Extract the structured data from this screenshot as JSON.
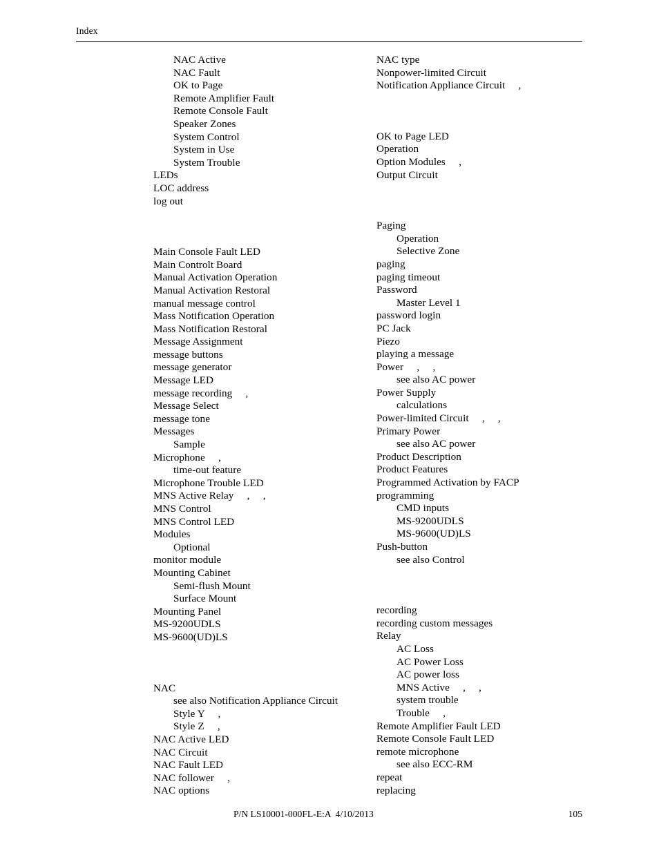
{
  "header": {
    "running_head": "Index"
  },
  "footer": {
    "part_number_line": "P/N LS10001-000FL-E:A  4/10/2013",
    "page_number": "105"
  },
  "index": {
    "left_column": [
      {
        "level": 2,
        "text": "NAC Active"
      },
      {
        "level": 2,
        "text": "NAC Fault"
      },
      {
        "level": 2,
        "text": "OK to Page"
      },
      {
        "level": 2,
        "text": "Remote Amplifier Fault"
      },
      {
        "level": 2,
        "text": "Remote Console Fault"
      },
      {
        "level": 2,
        "text": "Speaker Zones"
      },
      {
        "level": 2,
        "text": "System Control"
      },
      {
        "level": 2,
        "text": "System in Use"
      },
      {
        "level": 2,
        "text": "System Trouble"
      },
      {
        "level": 1,
        "text": "LEDs"
      },
      {
        "level": 1,
        "text": "LOC address"
      },
      {
        "level": 1,
        "text": "log out"
      },
      {
        "level": 0,
        "text": ""
      },
      {
        "level": 1,
        "text": "Main Console Fault LED"
      },
      {
        "level": 1,
        "text": "Main Controlt Board"
      },
      {
        "level": 1,
        "text": "Manual Activation Operation"
      },
      {
        "level": 1,
        "text": "Manual Activation Restoral"
      },
      {
        "level": 1,
        "text": "manual message control"
      },
      {
        "level": 1,
        "text": "Mass Notification Operation"
      },
      {
        "level": 1,
        "text": "Mass Notification Restoral"
      },
      {
        "level": 1,
        "text": "Message Assignment"
      },
      {
        "level": 1,
        "text": "message buttons"
      },
      {
        "level": 1,
        "text": "message generator"
      },
      {
        "level": 1,
        "text": "Message LED"
      },
      {
        "level": 1,
        "text": "message recording     ,"
      },
      {
        "level": 1,
        "text": "Message Select"
      },
      {
        "level": 1,
        "text": "message tone"
      },
      {
        "level": 1,
        "text": "Messages"
      },
      {
        "level": 2,
        "text": "Sample"
      },
      {
        "level": 1,
        "text": "Microphone     ,"
      },
      {
        "level": 2,
        "text": "time-out feature"
      },
      {
        "level": 1,
        "text": "Microphone Trouble LED"
      },
      {
        "level": 1,
        "text": "MNS Active Relay     ,     ,"
      },
      {
        "level": 1,
        "text": "MNS Control"
      },
      {
        "level": 1,
        "text": "MNS Control LED"
      },
      {
        "level": 1,
        "text": "Modules"
      },
      {
        "level": 2,
        "text": "Optional"
      },
      {
        "level": 1,
        "text": "monitor module"
      },
      {
        "level": 1,
        "text": "Mounting Cabinet"
      },
      {
        "level": 2,
        "text": "Semi-flush Mount"
      },
      {
        "level": 2,
        "text": "Surface Mount"
      },
      {
        "level": 1,
        "text": "Mounting Panel"
      },
      {
        "level": 1,
        "text": "MS-9200UDLS"
      },
      {
        "level": 1,
        "text": "MS-9600(UD)LS"
      },
      {
        "level": 0,
        "text": ""
      },
      {
        "level": 1,
        "text": "NAC"
      },
      {
        "level": 2,
        "text": "see also Notification Appliance Circuit"
      },
      {
        "level": 2,
        "text": "Style Y     ,"
      },
      {
        "level": 2,
        "text": "Style Z     ,"
      },
      {
        "level": 1,
        "text": "NAC Active LED"
      },
      {
        "level": 1,
        "text": "NAC Circuit"
      },
      {
        "level": 1,
        "text": "NAC Fault LED"
      },
      {
        "level": 1,
        "text": "NAC follower     ,"
      },
      {
        "level": 1,
        "text": "NAC options"
      }
    ],
    "right_column": [
      {
        "level": 1,
        "text": "NAC type"
      },
      {
        "level": 1,
        "text": "Nonpower-limited Circuit"
      },
      {
        "level": 1,
        "text": "Notification Appliance Circuit     ,"
      },
      {
        "level": 0,
        "text": ""
      },
      {
        "level": 1,
        "text": "OK to Page LED"
      },
      {
        "level": 1,
        "text": "Operation"
      },
      {
        "level": 1,
        "text": "Option Modules     ,"
      },
      {
        "level": 1,
        "text": "Output Circuit"
      },
      {
        "level": 0,
        "text": ""
      },
      {
        "level": 1,
        "text": "Paging"
      },
      {
        "level": 2,
        "text": "Operation"
      },
      {
        "level": 2,
        "text": "Selective Zone"
      },
      {
        "level": 1,
        "text": "paging"
      },
      {
        "level": 1,
        "text": "paging timeout"
      },
      {
        "level": 1,
        "text": "Password"
      },
      {
        "level": 2,
        "text": "Master Level 1"
      },
      {
        "level": 1,
        "text": "password login"
      },
      {
        "level": 1,
        "text": "PC Jack"
      },
      {
        "level": 1,
        "text": "Piezo"
      },
      {
        "level": 1,
        "text": "playing a message"
      },
      {
        "level": 1,
        "text": "Power     ,     ,"
      },
      {
        "level": 2,
        "text": "see also AC power"
      },
      {
        "level": 1,
        "text": "Power Supply"
      },
      {
        "level": 2,
        "text": "calculations"
      },
      {
        "level": 1,
        "text": "Power-limited Circuit     ,     ,"
      },
      {
        "level": 1,
        "text": "Primary Power"
      },
      {
        "level": 2,
        "text": "see also AC power"
      },
      {
        "level": 1,
        "text": "Product Description"
      },
      {
        "level": 1,
        "text": "Product Features"
      },
      {
        "level": 1,
        "text": "Programmed Activation by FACP"
      },
      {
        "level": 1,
        "text": "programming"
      },
      {
        "level": 2,
        "text": "CMD inputs"
      },
      {
        "level": 2,
        "text": "MS-9200UDLS"
      },
      {
        "level": 2,
        "text": "MS-9600(UD)LS"
      },
      {
        "level": 1,
        "text": "Push-button"
      },
      {
        "level": 2,
        "text": "see also Control"
      },
      {
        "level": 0,
        "text": ""
      },
      {
        "level": 1,
        "text": "recording"
      },
      {
        "level": 1,
        "text": "recording custom messages"
      },
      {
        "level": 1,
        "text": "Relay"
      },
      {
        "level": 2,
        "text": "AC Loss"
      },
      {
        "level": 2,
        "text": "AC Power Loss"
      },
      {
        "level": 2,
        "text": "AC power loss"
      },
      {
        "level": 2,
        "text": "MNS Active     ,     ,"
      },
      {
        "level": 2,
        "text": "system trouble"
      },
      {
        "level": 2,
        "text": "Trouble     ,"
      },
      {
        "level": 1,
        "text": "Remote Amplifier Fault LED"
      },
      {
        "level": 1,
        "text": "Remote Console Fault LED"
      },
      {
        "level": 1,
        "text": "remote microphone"
      },
      {
        "level": 2,
        "text": "see also ECC-RM"
      },
      {
        "level": 1,
        "text": "repeat"
      },
      {
        "level": 1,
        "text": "replacing"
      }
    ]
  }
}
